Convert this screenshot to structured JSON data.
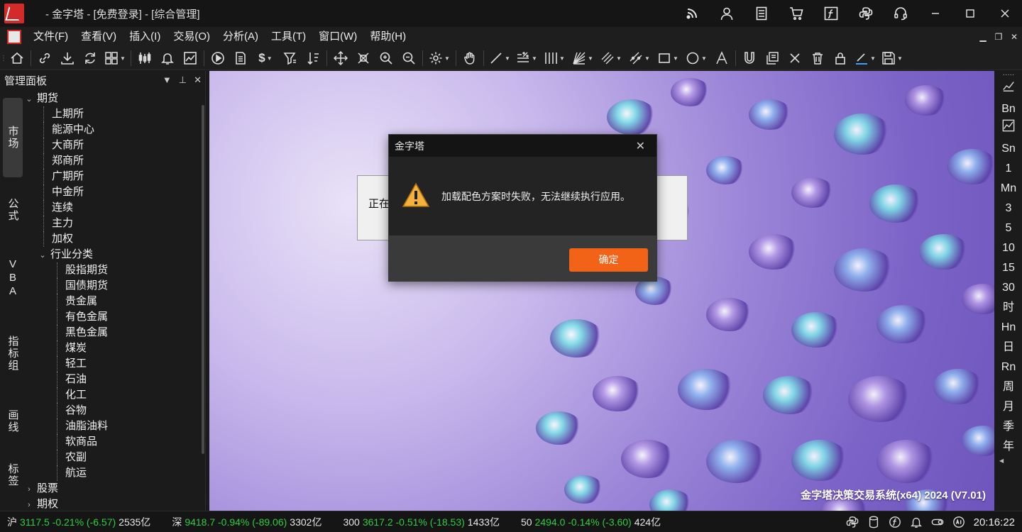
{
  "window": {
    "title": "- 金字塔 - [免费登录] - [综合管理]"
  },
  "menu": {
    "items": [
      "文件(F)",
      "查看(V)",
      "插入(I)",
      "交易(O)",
      "分析(A)",
      "工具(T)",
      "窗口(W)",
      "帮助(H)"
    ]
  },
  "panel": {
    "title": "管理面板",
    "tabs": [
      "市场",
      "公式",
      "VBA",
      "指标组",
      "画线",
      "标签"
    ],
    "tree": [
      {
        "label": "期货",
        "level": 0,
        "expanded": true
      },
      {
        "label": "上期所",
        "level": 1
      },
      {
        "label": "能源中心",
        "level": 1
      },
      {
        "label": "大商所",
        "level": 1
      },
      {
        "label": "郑商所",
        "level": 1
      },
      {
        "label": "广期所",
        "level": 1
      },
      {
        "label": "中金所",
        "level": 1
      },
      {
        "label": "连续",
        "level": 1
      },
      {
        "label": "主力",
        "level": 1
      },
      {
        "label": "加权",
        "level": 1
      },
      {
        "label": "行业分类",
        "level": 1,
        "expanded": true
      },
      {
        "label": "股指期货",
        "level": 2
      },
      {
        "label": "国债期货",
        "level": 2
      },
      {
        "label": "贵金属",
        "level": 2
      },
      {
        "label": "有色金属",
        "level": 2
      },
      {
        "label": "黑色金属",
        "level": 2
      },
      {
        "label": "煤炭",
        "level": 2
      },
      {
        "label": "轻工",
        "level": 2
      },
      {
        "label": "石油",
        "level": 2
      },
      {
        "label": "化工",
        "level": 2
      },
      {
        "label": "谷物",
        "level": 2
      },
      {
        "label": "油脂油料",
        "level": 2
      },
      {
        "label": "软商品",
        "level": 2
      },
      {
        "label": "农副",
        "level": 2
      },
      {
        "label": "航运",
        "level": 2
      },
      {
        "label": "股票",
        "level": 0,
        "expanded": false
      },
      {
        "label": "期权",
        "level": 0,
        "expanded": false
      }
    ]
  },
  "main": {
    "loading_text": "正在",
    "brand_text": "金字塔决策交易系统(x64) 2024 (V7.01)"
  },
  "dialog": {
    "title": "金字塔",
    "message": "加载配色方案时失败，无法继续执行应用。",
    "ok_label": "确定",
    "icon": "warning-icon"
  },
  "periods": [
    "Bn",
    "Sn",
    "1",
    "Mn",
    "3",
    "5",
    "10",
    "15",
    "30",
    "时",
    "Hn",
    "日",
    "Rn",
    "周",
    "月",
    "季",
    "年"
  ],
  "status": {
    "indices": [
      {
        "name": "沪",
        "value": "3117.5 -0.21% (-6.57)",
        "amount": "2535亿"
      },
      {
        "name": "深",
        "value": "9418.7 -0.94% (-89.06)",
        "amount": "3302亿"
      },
      {
        "name": "300",
        "value": "3617.2 -0.51% (-18.53)",
        "amount": "1433亿"
      },
      {
        "name": "50",
        "value": "2494.0 -0.14% (-3.60)",
        "amount": "424亿"
      }
    ],
    "time": "20:16:22"
  },
  "colors": {
    "accent": "#f26318",
    "down": "#2ecc40",
    "bg": "#1b1b1b"
  }
}
